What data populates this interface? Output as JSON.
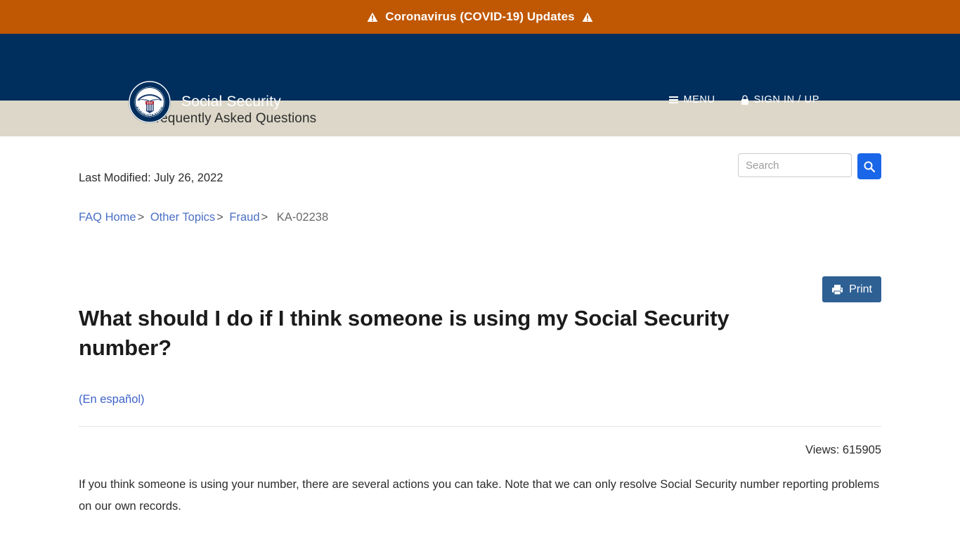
{
  "alert_banner": {
    "text": "Coronavirus (COVID-19) Updates",
    "left_icon": "warning-triangle-icon",
    "right_icon": "warning-triangle-icon",
    "background_color": "#c05702",
    "text_color": "#ffffff"
  },
  "masthead": {
    "brand_name": "Social Security",
    "logo_icon": "ssa-seal-icon",
    "seal_text_top": "SOCIAL SECURITY",
    "seal_text_bottom": "ADMINISTRATION",
    "seal_shield_label": "USA",
    "background_color": "#002e5d",
    "nav": [
      {
        "label": "MENU",
        "icon": "hamburger-menu-icon"
      },
      {
        "label": "SIGN IN / UP",
        "icon": "lock-icon"
      }
    ]
  },
  "page_strip": {
    "title": "Frequently Asked Questions",
    "background_color": "#dcd7c8"
  },
  "search": {
    "value": "",
    "placeholder": "Search",
    "button_icon": "search-icon",
    "button_color": "#1a66e8"
  },
  "meta": {
    "last_modified": "Last Modified: July 26, 2022",
    "views": "Views: 615905"
  },
  "breadcrumb": {
    "items": [
      {
        "label": "FAQ Home",
        "link": true
      },
      {
        "label": "Other Topics",
        "link": true
      },
      {
        "label": "Fraud",
        "link": true
      },
      {
        "label": "KA-02238",
        "link": false
      }
    ],
    "separator": ">",
    "link_color": "#4a6fc4"
  },
  "toolbar": {
    "print_label": "Print",
    "print_icon": "printer-icon",
    "print_color": "#2e6094"
  },
  "article": {
    "question": "What should I do if I think someone is using my Social Security number?",
    "spanish_link": "(En español)",
    "body": "If you think someone is using your number, there are several actions you can take. Note that we can only resolve Social Security number reporting problems on our own records."
  }
}
